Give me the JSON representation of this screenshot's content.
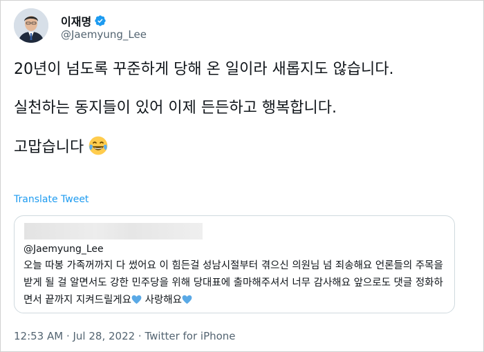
{
  "author": {
    "display_name": "이재명",
    "handle": "@Jaemyung_Lee"
  },
  "tweet": {
    "paragraphs": [
      "20년이 넘도록 꾸준하게 당해 온 일이라 새롭지도 않습니다.",
      "실천하는 동지들이 있어 이제 든든하고 행복합니다.",
      "고맙습니다"
    ],
    "emoji": "face-with-tears-of-joy"
  },
  "translate_label": "Translate Tweet",
  "quoted": {
    "handle": "@Jaemyung_Lee",
    "text_part1": "오늘 따봉 가족꺼까지 다 썼어요 이 힘든걸 성남시절부터 겪으신 의원님 넘 죄송해요 언론들의 주목을 받게 될 걸 알면서도 강한 민주당을 위해 당대표에 출마해주셔서 너무 감사해요 앞으로도 댓글 정화하면서 끝까지 지켜드릴게요",
    "text_part2": " 사랑해요",
    "heart_color": "#5aa9e6"
  },
  "meta": "12:53 AM · Jul 28, 2022 · Twitter for iPhone",
  "colors": {
    "link": "#1d9bf0",
    "secondary_text": "#536471",
    "verified": "#1d9bf0"
  }
}
